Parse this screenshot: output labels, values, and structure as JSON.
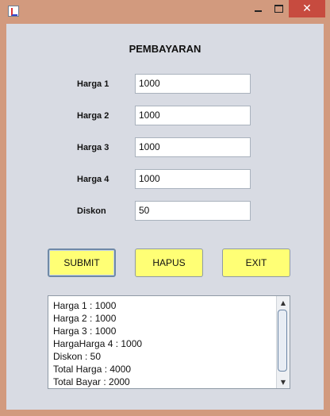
{
  "window": {
    "title": ""
  },
  "heading": "PEMBAYARAN",
  "fields": [
    {
      "label": "Harga 1",
      "value": "1000"
    },
    {
      "label": "Harga 2",
      "value": "1000"
    },
    {
      "label": "Harga 3",
      "value": "1000"
    },
    {
      "label": "Harga 4",
      "value": "1000"
    },
    {
      "label": "Diskon",
      "value": "50"
    }
  ],
  "buttons": {
    "submit": "SUBMIT",
    "hapus": "HAPUS",
    "exit": "EXIT"
  },
  "output_lines": [
    "Harga 1 : 1000",
    "Harga 2 : 1000",
    "Harga 3 : 1000",
    "HargaHarga 4 : 1000",
    "Diskon : 50",
    "Total Harga : 4000",
    "Total Bayar : 2000"
  ],
  "window_controls": {
    "close": "✕"
  },
  "icons": {
    "app": "java-app-icon",
    "minimize": "minimize-icon",
    "maximize": "maximize-icon",
    "close": "close-icon",
    "scroll_up": "scroll-up-arrow-icon",
    "scroll_down": "scroll-down-arrow-icon"
  }
}
